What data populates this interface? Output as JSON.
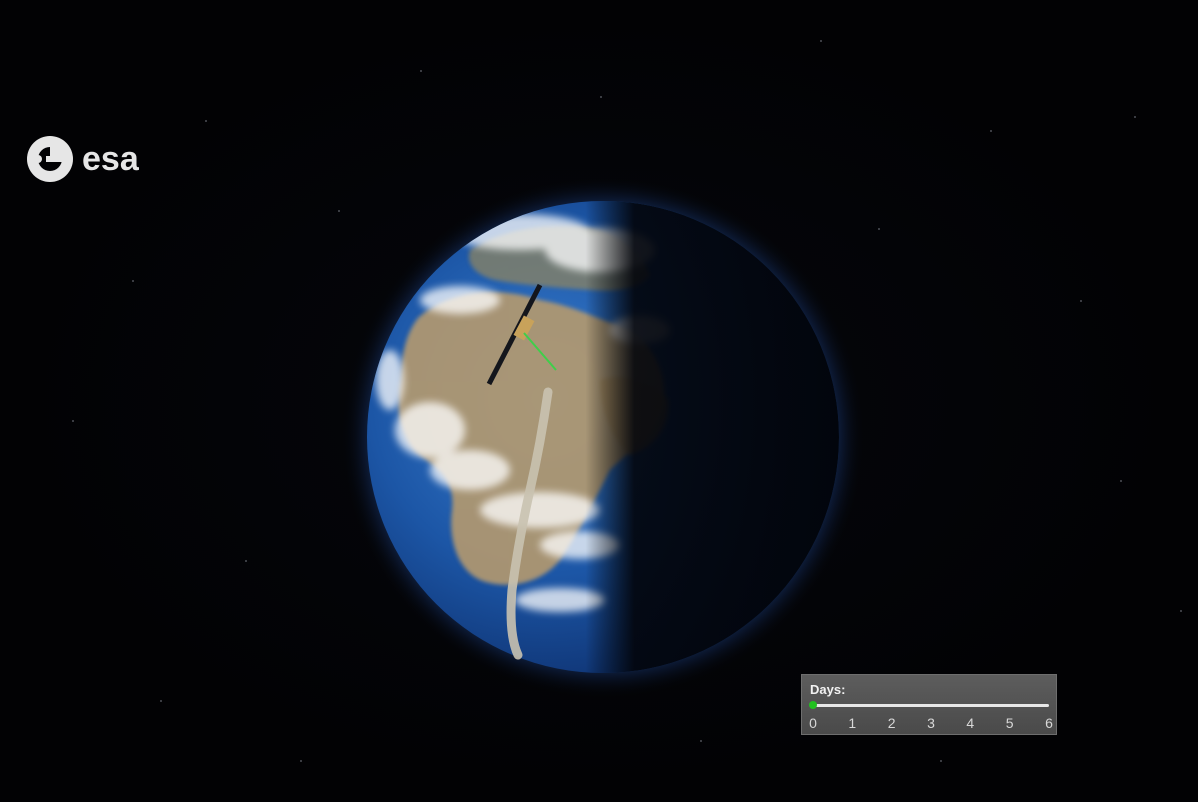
{
  "logo": {
    "text": "esa",
    "icon": "esa-logo-icon"
  },
  "days_panel": {
    "label": "Days:",
    "ticks": [
      "0",
      "1",
      "2",
      "3",
      "4",
      "5",
      "6"
    ],
    "value": 0,
    "max": 6,
    "handle_color": "#22c020"
  },
  "colors": {
    "background": "#020204",
    "ocean": "#1e5aa8",
    "atmosphere_glow": "#2f6fd6",
    "land": "#b59a6e",
    "ground_track": "#c9c2b0",
    "link_line": "#3ecf4a"
  }
}
